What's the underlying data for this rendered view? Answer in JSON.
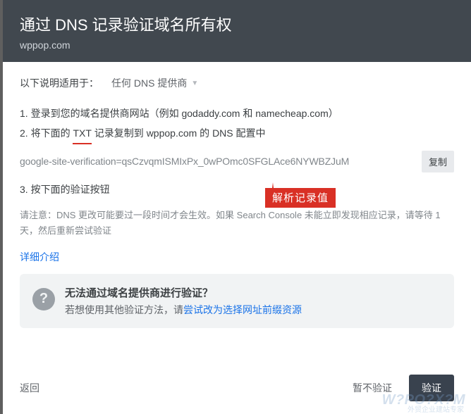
{
  "header": {
    "title": "通过 DNS 记录验证域名所有权",
    "subtitle": "wppop.com"
  },
  "provider": {
    "label": "以下说明适用于：",
    "value": "任何 DNS 提供商"
  },
  "steps": {
    "step1": "1. 登录到您的域名提供商网站（例如 godaddy.com 和 namecheap.com）",
    "step2_pre": "2. 将下面的 ",
    "step2_txt": "TXT",
    "step2_post": " 记录复制到 wppop.com 的 DNS 配置中",
    "step3": "3. 按下面的验证按钮"
  },
  "txt_record": {
    "value": "google-site-verification=qsCzvqmISMIxPx_0wPOmc0SFGLAce6NYWBZJuM",
    "copy_label": "复制"
  },
  "annotation": {
    "label": "解析记录值"
  },
  "note": "请注意：DNS 更改可能要过一段时间才会生效。如果 Search Console 未能立即发现相应记录，请等待 1 天，然后重新尝试验证",
  "details_link": "详细介绍",
  "info_box": {
    "title": "无法通过域名提供商进行验证？",
    "text_pre": "若想使用其他验证方法，请",
    "link": "尝试改为选择网址前缀资源"
  },
  "footer": {
    "back": "返回",
    "later": "暂不验证",
    "verify": "验证"
  },
  "watermark": {
    "main": "W?PO?X?M",
    "sub": "外贸企业建站专家"
  }
}
